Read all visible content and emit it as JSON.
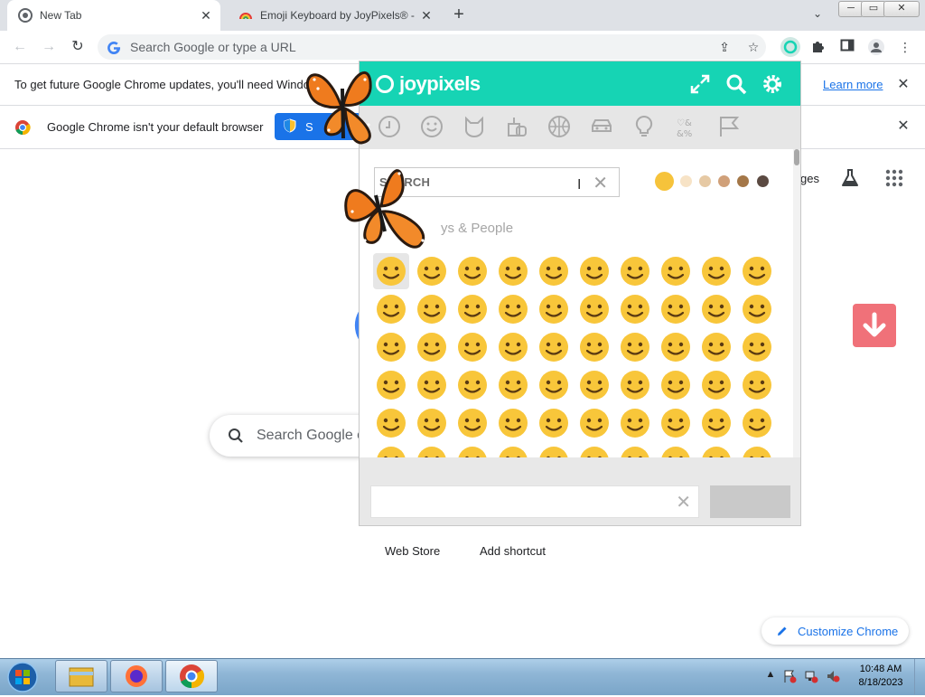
{
  "chrome": {
    "tabs": [
      {
        "title": "New Tab",
        "active": true
      },
      {
        "title": "Emoji Keyboard by JoyPixels® - ("
      }
    ],
    "new_tab_symbol": "+",
    "omnibox_placeholder": "Search Google or type a URL",
    "window_controls": {
      "minimize": "─",
      "maximize": "▭",
      "close": "✕"
    }
  },
  "infobars": {
    "update_text": "To get future Google Chrome updates, you'll need Windows",
    "learn_more": "Learn more",
    "default_text": "Google Chrome isn't your default browser",
    "set_default_label": "S"
  },
  "ntp": {
    "images_link": "ges",
    "search_placeholder": "Search Google o",
    "shortcuts": [
      {
        "label": "Web Store"
      },
      {
        "label": "Add shortcut"
      }
    ],
    "customize_label": "Customize Chrome"
  },
  "joypixels": {
    "logo": "joypixels",
    "search_placeholder": "SEARCH",
    "section_title": "ys & People",
    "categories": [
      "recent-icon",
      "smileys-icon",
      "animals-icon",
      "food-icon",
      "activity-icon",
      "travel-icon",
      "objects-icon",
      "symbols-icon",
      "flags-icon"
    ],
    "skin_tones": [
      "#f6c33b",
      "#f7e3c6",
      "#e6c9a4",
      "#d0a079",
      "#a47748",
      "#5b4a42"
    ],
    "input_value": "",
    "copy_label": ""
  },
  "emoji": {
    "rows": [
      [
        "😀",
        "😃",
        "😄",
        "😁",
        "😆",
        "🥹",
        "😅",
        "😂",
        "🤣",
        "🥲"
      ],
      [
        "☺️",
        "😊",
        "😇",
        "🙂",
        "🙃",
        "😉",
        "😌",
        "😍",
        "🥰",
        "😘"
      ],
      [
        "😗",
        "😙",
        "😚",
        "😋",
        "😛",
        "😝",
        "😜",
        "🤪",
        "🤨",
        "🧐"
      ],
      [
        "🤓",
        "😎",
        "🥸",
        "🤩",
        "🥳",
        "😏",
        "😒",
        "😞",
        "😔",
        "😟"
      ],
      [
        "😕",
        "🙁",
        "☹️",
        "😣",
        "😖",
        "😫",
        "😩",
        "🥺",
        "😢",
        "😭"
      ],
      [
        "😤",
        "😠",
        "😡",
        "🤬",
        "🤯",
        "😳",
        "🥵",
        "🥶",
        "😱",
        "😨"
      ]
    ]
  },
  "taskbar": {
    "time": "10:48 AM",
    "date": "8/18/2023"
  },
  "colors": {
    "joypixels_teal": "#16d4b4",
    "chrome_blue": "#1a73e8",
    "emoji_yellow": "#f8c63a"
  }
}
